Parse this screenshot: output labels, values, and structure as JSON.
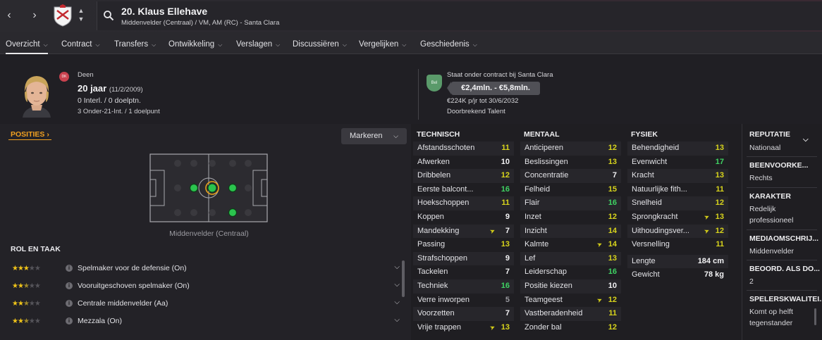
{
  "header": {
    "player_title": "20. Klaus Ellehave",
    "player_subtitle": "Middenvelder (Centraal) / VM, AM (RC) - Santa Clara"
  },
  "tabs": [
    {
      "label": "Overzicht",
      "active": true
    },
    {
      "label": "Contract"
    },
    {
      "label": "Transfers"
    },
    {
      "label": "Ontwikkeling"
    },
    {
      "label": "Verslagen"
    },
    {
      "label": "Discussiëren"
    },
    {
      "label": "Vergelijken"
    },
    {
      "label": "Geschiedenis"
    }
  ],
  "profile": {
    "flag_text": "DK",
    "nationality": "Deen",
    "age": "20 jaar",
    "dob": "(11/2/2009)",
    "caps": "0 Interl. / 0 doelptn.",
    "u21": "3 Onder-21-Int. / 1 doelpunt"
  },
  "contract": {
    "badge": "Bel",
    "status": "Staat onder contract bij Santa Clara",
    "value": "€2,4mln. - €5,8mln.",
    "wage": "€224K p/jr tot 30/6/2032",
    "talent": "Doorbrekend Talent"
  },
  "positions": {
    "label": "POSITIES",
    "markeren": "Markeren",
    "caption": "Middenvelder (Centraal)"
  },
  "roles": {
    "header": "ROL EN TAAK",
    "items": [
      {
        "name": "Spelmaker voor de defensie (On)",
        "stars": 3
      },
      {
        "name": "Vooruitgeschoven spelmaker (On)",
        "stars": 2.5
      },
      {
        "name": "Centrale middenvelder (Aa)",
        "stars": 2.5
      },
      {
        "name": "Mezzala (On)",
        "stars": 2.5
      }
    ]
  },
  "technisch": {
    "header": "TECHNISCH",
    "rows": [
      {
        "name": "Afstandsschoten",
        "value": "11",
        "color": "yellow"
      },
      {
        "name": "Afwerken",
        "value": "10",
        "color": "white"
      },
      {
        "name": "Dribbelen",
        "value": "12",
        "color": "yellow"
      },
      {
        "name": "Eerste balcont...",
        "value": "16",
        "color": "green"
      },
      {
        "name": "Hoekschoppen",
        "value": "11",
        "color": "yellow"
      },
      {
        "name": "Koppen",
        "value": "9",
        "color": "white"
      },
      {
        "name": "Mandekking",
        "value": "7",
        "color": "white",
        "arrow": true
      },
      {
        "name": "Passing",
        "value": "13",
        "color": "yellow"
      },
      {
        "name": "Strafschoppen",
        "value": "9",
        "color": "white"
      },
      {
        "name": "Tackelen",
        "value": "7",
        "color": "white"
      },
      {
        "name": "Techniek",
        "value": "16",
        "color": "green"
      },
      {
        "name": "Verre inworpen",
        "value": "5",
        "color": "grey"
      },
      {
        "name": "Voorzetten",
        "value": "7",
        "color": "white"
      },
      {
        "name": "Vrije trappen",
        "value": "13",
        "color": "yellow",
        "arrow": true
      }
    ]
  },
  "mentaal": {
    "header": "MENTAAL",
    "rows": [
      {
        "name": "Anticiperen",
        "value": "12",
        "color": "yellow"
      },
      {
        "name": "Beslissingen",
        "value": "13",
        "color": "yellow"
      },
      {
        "name": "Concentratie",
        "value": "7",
        "color": "white"
      },
      {
        "name": "Felheid",
        "value": "15",
        "color": "yellow"
      },
      {
        "name": "Flair",
        "value": "16",
        "color": "green"
      },
      {
        "name": "Inzet",
        "value": "12",
        "color": "yellow"
      },
      {
        "name": "Inzicht",
        "value": "14",
        "color": "yellow"
      },
      {
        "name": "Kalmte",
        "value": "14",
        "color": "yellow",
        "arrow": true
      },
      {
        "name": "Lef",
        "value": "13",
        "color": "yellow"
      },
      {
        "name": "Leiderschap",
        "value": "16",
        "color": "green"
      },
      {
        "name": "Positie kiezen",
        "value": "10",
        "color": "white"
      },
      {
        "name": "Teamgeest",
        "value": "12",
        "color": "yellow",
        "arrow": true
      },
      {
        "name": "Vastberadenheid",
        "value": "11",
        "color": "yellow"
      },
      {
        "name": "Zonder bal",
        "value": "12",
        "color": "yellow"
      }
    ]
  },
  "fysiek": {
    "header": "FYSIEK",
    "rows": [
      {
        "name": "Behendigheid",
        "value": "13",
        "color": "yellow"
      },
      {
        "name": "Evenwicht",
        "value": "17",
        "color": "green"
      },
      {
        "name": "Kracht",
        "value": "13",
        "color": "yellow"
      },
      {
        "name": "Natuurlijke fith...",
        "value": "11",
        "color": "yellow"
      },
      {
        "name": "Snelheid",
        "value": "12",
        "color": "yellow"
      },
      {
        "name": "Sprongkracht",
        "value": "13",
        "color": "yellow",
        "arrow": true
      },
      {
        "name": "Uithoudingsver...",
        "value": "12",
        "color": "yellow",
        "arrow": true
      },
      {
        "name": "Versnelling",
        "value": "11",
        "color": "yellow"
      },
      {
        "name": "Lengte",
        "value": "184 cm",
        "color": "white"
      },
      {
        "name": "Gewicht",
        "value": "78 kg",
        "color": "white"
      }
    ]
  },
  "info": {
    "reputatie_head": "REPUTATIE",
    "reputatie_val": "Nationaal",
    "been_head": "BEENVOORKE...",
    "been_val": "Rechts",
    "karakter_head": "KARAKTER",
    "karakter_val": "Redelijk professioneel",
    "media_head": "MEDIAOMSCHRIJ...",
    "media_val": "Middenvelder",
    "beoord_head": "BEOORD. ALS DO...",
    "beoord_val": "2",
    "kwal_head": "SPELERSKWALITEI...",
    "kwal_val": "Komt op helft tegenstander"
  },
  "colors": {
    "yellow": "#d8d41c",
    "green": "#3fd263",
    "accent_orange": "#f0a020"
  }
}
